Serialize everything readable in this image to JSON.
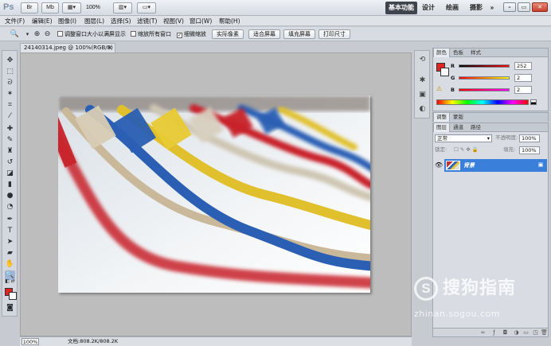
{
  "app": {
    "logo": "Ps",
    "zoom_level": "100%",
    "workspaces": [
      "基本功能",
      "设计",
      "绘画",
      "摄影"
    ],
    "more": "»"
  },
  "menu": [
    "文件(F)",
    "编辑(E)",
    "图像(I)",
    "图层(L)",
    "选择(S)",
    "滤镜(T)",
    "视图(V)",
    "窗口(W)",
    "帮助(H)"
  ],
  "options": {
    "resize_windows": "调整窗口大小以满屏显示",
    "zoom_all": "缩放所有窗口",
    "scrubby_zoom": "细微缩放",
    "actual_pixels": "实际像素",
    "fit_screen": "适合屏幕",
    "fill_screen": "填充屏幕",
    "print_size": "打印尺寸"
  },
  "document": {
    "tab_title": "24140314.jpeg @ 100%(RGB/8)",
    "status_zoom": "100%",
    "status_doc": "文档:808.2K/808.2K"
  },
  "color_panel": {
    "tabs": [
      "颜色",
      "色板",
      "样式"
    ],
    "r_label": "R",
    "g_label": "G",
    "b_label": "B",
    "r": "252",
    "g": "2",
    "b": "2",
    "foreground": "#e52222"
  },
  "adjust_panel": {
    "tabs": [
      "调整",
      "蒙版"
    ]
  },
  "layers_panel": {
    "tabs": [
      "图层",
      "通道",
      "路径"
    ],
    "blend_mode": "正常",
    "opacity_label": "不透明度:",
    "opacity": "100%",
    "lock_label": "锁定:",
    "fill_label": "填充:",
    "fill": "100%",
    "layer_name": "背景"
  },
  "watermark": {
    "logo": "S",
    "text": "搜狗指南",
    "url": "zhinan.sogou.com"
  },
  "icons": [
    "move-icon",
    "marquee-icon",
    "lasso-icon",
    "magic-wand-icon",
    "crop-icon",
    "eyedropper-icon",
    "heal-icon",
    "brush-icon",
    "stamp-icon",
    "history-brush-icon",
    "eraser-icon",
    "gradient-icon",
    "blur-icon",
    "dodge-icon",
    "pen-icon",
    "type-icon",
    "path-select-icon",
    "shape-icon",
    "hand-icon",
    "zoom-icon"
  ]
}
